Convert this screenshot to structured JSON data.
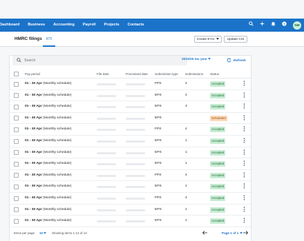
{
  "nav": {
    "items": [
      "Dashboard",
      "Business",
      "Accounting",
      "Payroll",
      "Projects",
      "Contacts"
    ],
    "avatar_initials": "NM",
    "icons": [
      "search-icon",
      "plus-icon",
      "bell-icon",
      "help-icon"
    ]
  },
  "header": {
    "title": "HMRC filings",
    "tab_rti": "RTI",
    "create_eyu_label": "Create EYU",
    "update_cis_label": "Update CIS"
  },
  "toolbar": {
    "search_placeholder": "Search",
    "tax_year": "2024/25 tax year",
    "refresh_label": "Refresh"
  },
  "table": {
    "columns": [
      "Pay period",
      "File date",
      "Processed date",
      "Submission type",
      "Submissions",
      "Status"
    ],
    "rows": [
      {
        "period_bold": "01 - 30 Apr",
        "period_rest": " (Monthly schedule)",
        "type": "FPS",
        "submissions": "4",
        "status": "Accepted"
      },
      {
        "period_bold": "01 - 30 Apr",
        "period_rest": " (Monthly schedule)",
        "type": "EPS",
        "submissions": "4",
        "status": "Accepted"
      },
      {
        "period_bold": "01 - 30 Apr",
        "period_rest": " (Monthly schedule)",
        "type": "EPS",
        "submissions": "3",
        "status": "Accepted"
      },
      {
        "period_bold": "01 - 30 Apr",
        "period_rest": " (Monthly schedule)",
        "type": "EPS",
        "submissions": "",
        "status": "Scheduled"
      },
      {
        "period_bold": "01 - 30 Apr",
        "period_rest": " (Monthly schedule)",
        "type": "FPS",
        "submissions": "4",
        "status": "Accepted"
      },
      {
        "period_bold": "01 - 30 Apr",
        "period_rest": " (Monthly schedule)",
        "type": "EPS",
        "submissions": "1",
        "status": "Accepted"
      },
      {
        "period_bold": "01 - 30 Apr",
        "period_rest": " (Monthly schedule)",
        "type": "EPS",
        "submissions": "1",
        "status": "Accepted"
      },
      {
        "period_bold": "01 - 30 Apr",
        "period_rest": " (Monthly schedule)",
        "type": "EPS",
        "submissions": "1",
        "status": "Accepted"
      },
      {
        "period_bold": "01 - 30 Apr",
        "period_rest": " (Monthly schedule)",
        "type": "FPS",
        "submissions": "4",
        "status": "Accepted"
      },
      {
        "period_bold": "01 - 30 Apr",
        "period_rest": " (Monthly schedule)",
        "type": "EPS",
        "submissions": "1",
        "status": "Accepted"
      },
      {
        "period_bold": "01 - 30 Apr",
        "period_rest": " (Monthly schedule)",
        "type": "FPS",
        "submissions": "4",
        "status": "Accepted"
      },
      {
        "period_bold": "01 - 30 Apr",
        "period_rest": " (Monthly schedule)",
        "type": "EPS",
        "submissions": "1",
        "status": "Accepted"
      },
      {
        "period_bold": "01 - 30 Apr",
        "period_rest": " (Monthly schedule)",
        "type": "EPS",
        "submissions": "1",
        "status": "Accepted"
      }
    ]
  },
  "footer": {
    "items_per_page_label": "Items per page",
    "items_per_page_value": "10",
    "showing": "Showing items 1-13 of 13",
    "page_label": "Page 1 of 1"
  },
  "colors": {
    "brand": "#1b73c9",
    "accepted_bg": "#c7ecd2",
    "scheduled_bg": "#fbd9b8"
  }
}
